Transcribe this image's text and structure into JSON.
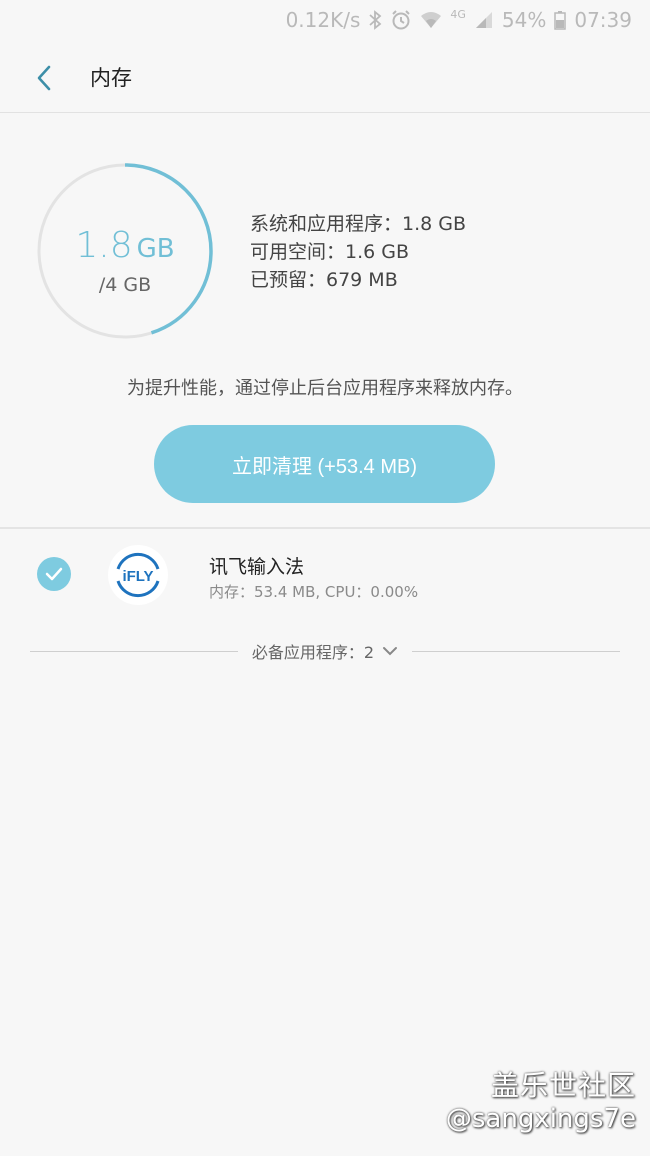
{
  "status_bar": {
    "network_speed": "0.12K/s",
    "network_type": "4G",
    "battery": "54%",
    "time": "07:39",
    "icons": [
      "bluetooth-icon",
      "alarm-icon",
      "wifi-icon",
      "signal-icon",
      "battery-icon"
    ]
  },
  "header": {
    "title": "内存",
    "back_icon": "chevron-left-icon"
  },
  "memory": {
    "used_value": "1.8",
    "used_unit": "GB",
    "total": "/4 GB",
    "used_fraction": 0.45,
    "stats": [
      "系统和应用程序：1.8 GB",
      "可用空间：1.6 GB",
      "已预留：679 MB"
    ],
    "tip": "为提升性能，通过停止后台应用程序来释放内存。",
    "clean_button": "立即清理 (+53.4 MB)"
  },
  "apps": [
    {
      "name": "讯飞输入法",
      "meta": "内存：53.4 MB, CPU：0.00%",
      "checked": true,
      "icon_text": "iFLY"
    }
  ],
  "essential_apps_label": "必备应用程序：2",
  "watermark": {
    "line1": "盖乐世社区",
    "line2": "@sangxings7e"
  },
  "colors": {
    "accent": "#7ecbe0",
    "ring_accent": "#71bfd6",
    "ring_track": "#e3e3e3",
    "background": "#f7f7f7"
  }
}
